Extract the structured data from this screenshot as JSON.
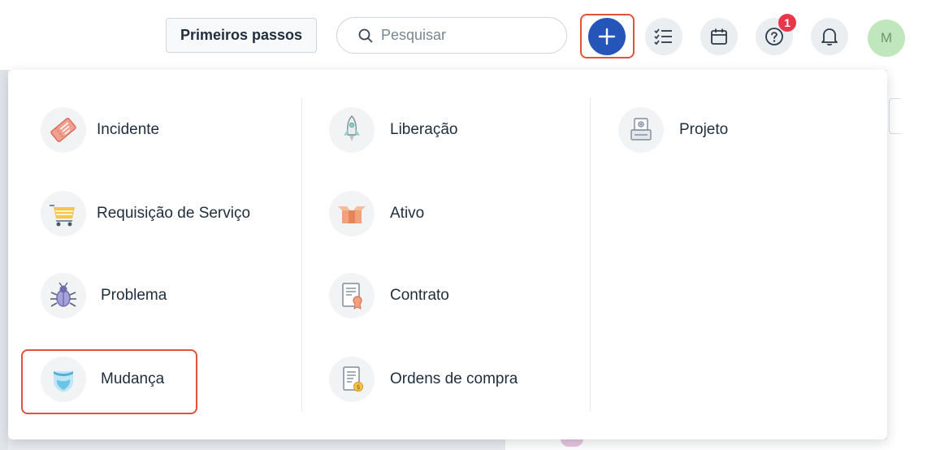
{
  "topbar": {
    "getting_started_label": "Primeiros passos",
    "search_placeholder": "Pesquisar",
    "help_badge_count": "1",
    "avatar_initial": "M"
  },
  "new_menu": {
    "columns": [
      [
        {
          "label": "Incidente",
          "icon": "ticket-icon"
        },
        {
          "label": "Requisição de Serviço",
          "icon": "shopping-cart-icon"
        },
        {
          "label": "Problema",
          "icon": "bug-icon"
        },
        {
          "label": "Mudança",
          "icon": "shield-icon"
        }
      ],
      [
        {
          "label": "Liberação",
          "icon": "rocket-icon"
        },
        {
          "label": "Ativo",
          "icon": "box-icon"
        },
        {
          "label": "Contrato",
          "icon": "certificate-icon"
        },
        {
          "label": "Ordens de compra",
          "icon": "invoice-icon"
        }
      ],
      [
        {
          "label": "Projeto",
          "icon": "project-icon"
        }
      ]
    ]
  },
  "colors": {
    "accent_blue": "#2655b9",
    "highlight_red": "#e0533b",
    "badge_red": "#e9364b"
  }
}
